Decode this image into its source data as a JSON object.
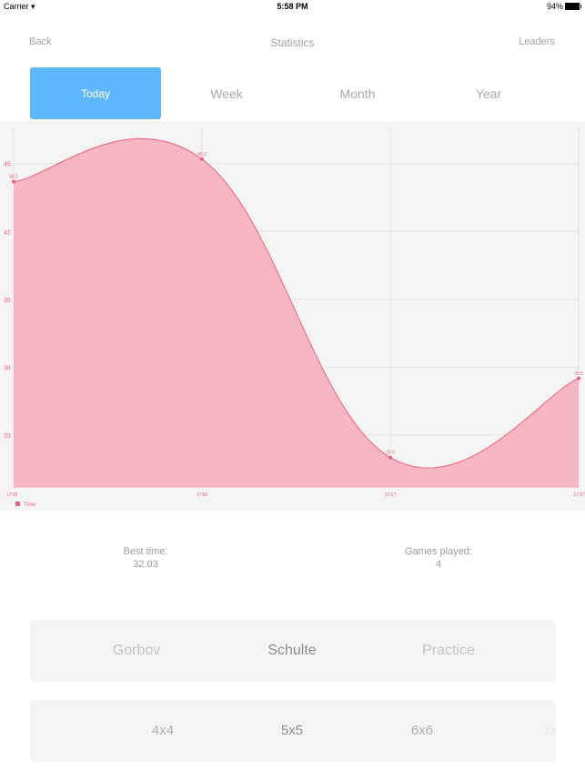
{
  "status_bar": {
    "carrier": "Carrier",
    "wifi_icon": "wifi-icon",
    "time": "5:58 PM",
    "battery": "94%"
  },
  "nav": {
    "back": "Back",
    "title": "Statistics",
    "leaders": "Leaders"
  },
  "period_tabs": [
    {
      "label": "Today",
      "active": true
    },
    {
      "label": "Week",
      "active": false
    },
    {
      "label": "Month",
      "active": false
    },
    {
      "label": "Year",
      "active": false
    }
  ],
  "colors": {
    "accent": "#5fb8fd",
    "series": "#f0607a",
    "fill": "#f7b6c3",
    "card": "#f4f4f4"
  },
  "chart_data": {
    "type": "area",
    "title": "",
    "xlabel": "",
    "ylabel": "",
    "x": [
      "17:55",
      "17:56",
      "17:57",
      "17:57"
    ],
    "series": [
      {
        "name": "Time",
        "values": [
          44.2,
          45.2,
          32.0,
          35.5
        ]
      }
    ],
    "point_labels": [
      "44.2",
      "45.2",
      "32.0",
      "35.5"
    ],
    "yticks": [
      33,
      36,
      39,
      42,
      45
    ],
    "ylim": [
      30.7,
      46.6
    ],
    "grid": true,
    "legend": "bottom-left"
  },
  "stats": {
    "best_time_label": "Best time:",
    "best_time_value": "32.03",
    "games_played_label": "Games played:",
    "games_played_value": "4"
  },
  "game_types": [
    {
      "label": "Gorbov",
      "selected": false
    },
    {
      "label": "Schulte",
      "selected": true
    },
    {
      "label": "Practice",
      "selected": false
    }
  ],
  "grid_sizes": [
    {
      "label": "4x4"
    },
    {
      "label": "5x5"
    },
    {
      "label": "6x6"
    },
    {
      "label": "7x"
    }
  ]
}
